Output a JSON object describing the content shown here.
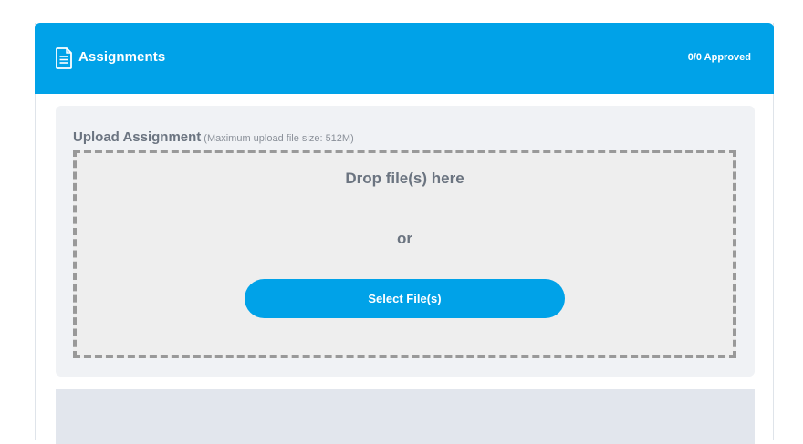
{
  "header": {
    "title": "Assignments",
    "status": "0/0 Approved",
    "icon": "document-icon",
    "color": "#00a2e8"
  },
  "upload": {
    "label": "Upload Assignment",
    "note": "(Maximum upload file size: 512M)",
    "drop_text": "Drop file(s) here",
    "or_text": "or",
    "button_label": "Select File(s)"
  }
}
